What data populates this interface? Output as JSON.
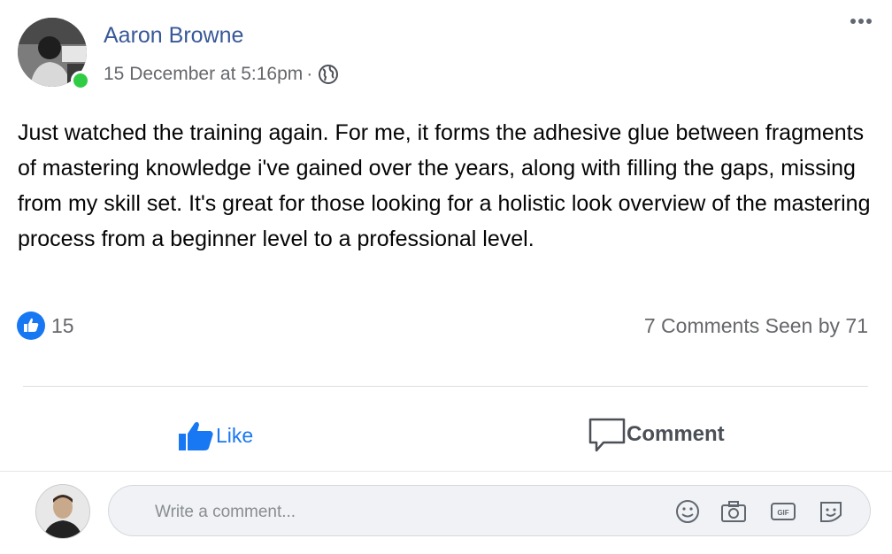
{
  "post": {
    "author": "Aaron Browne",
    "timestamp": "15 December at 5:16pm",
    "separator": "·",
    "privacy_icon": "globe-icon",
    "body": "Just watched the training again. For me, it forms the adhesive glue between fragments of mastering knowledge i've gained over the years, along with filling the gaps, missing from my skill set. It's great for those looking for a holistic look overview of the mastering process from a beginner level to a professional level."
  },
  "stats": {
    "like_count": "15",
    "comments_and_seen": "7 Comments Seen by 71"
  },
  "actions": {
    "like_label": "Like",
    "comment_label": "Comment"
  },
  "composer": {
    "placeholder": "Write a comment..."
  },
  "colors": {
    "name_blue": "#385898",
    "like_blue": "#1877f2",
    "online_green": "#31cc46",
    "secondary_text": "#65676b"
  }
}
